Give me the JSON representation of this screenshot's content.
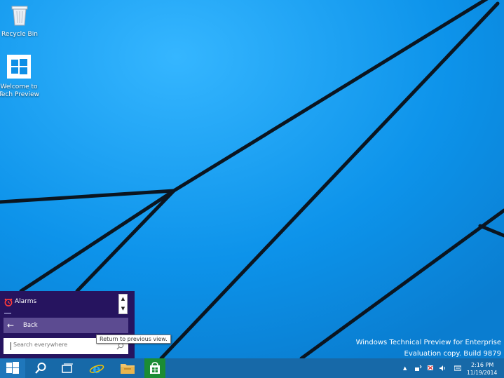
{
  "desktop": {
    "icons": [
      {
        "label": "Recycle Bin",
        "icon": "recycle-bin-icon"
      },
      {
        "label_line1": "Welcome to",
        "label_line2": "Tech Preview",
        "icon": "windows-logo-icon"
      }
    ],
    "watermark": {
      "line1": "Windows Technical Preview for Enterprise",
      "line2": "Evaluation copy. Build 9879"
    }
  },
  "start_menu": {
    "app": {
      "label": "Alarms",
      "icon": "alarm-clock-icon"
    },
    "back_label": "Back",
    "search_placeholder": "Search everywhere",
    "tooltip": "Return to previous view."
  },
  "taskbar": {
    "buttons": [
      "start-button",
      "search-button",
      "task-view-button",
      "internet-explorer-button",
      "file-explorer-button",
      "store-button"
    ],
    "clock": {
      "time": "2:16 PM",
      "date": "11/19/2014"
    }
  },
  "colors": {
    "background": "#0e8fe6",
    "start_menu": "#26145f",
    "back_button": "#5c4b91",
    "taskbar": "#1769a8"
  }
}
